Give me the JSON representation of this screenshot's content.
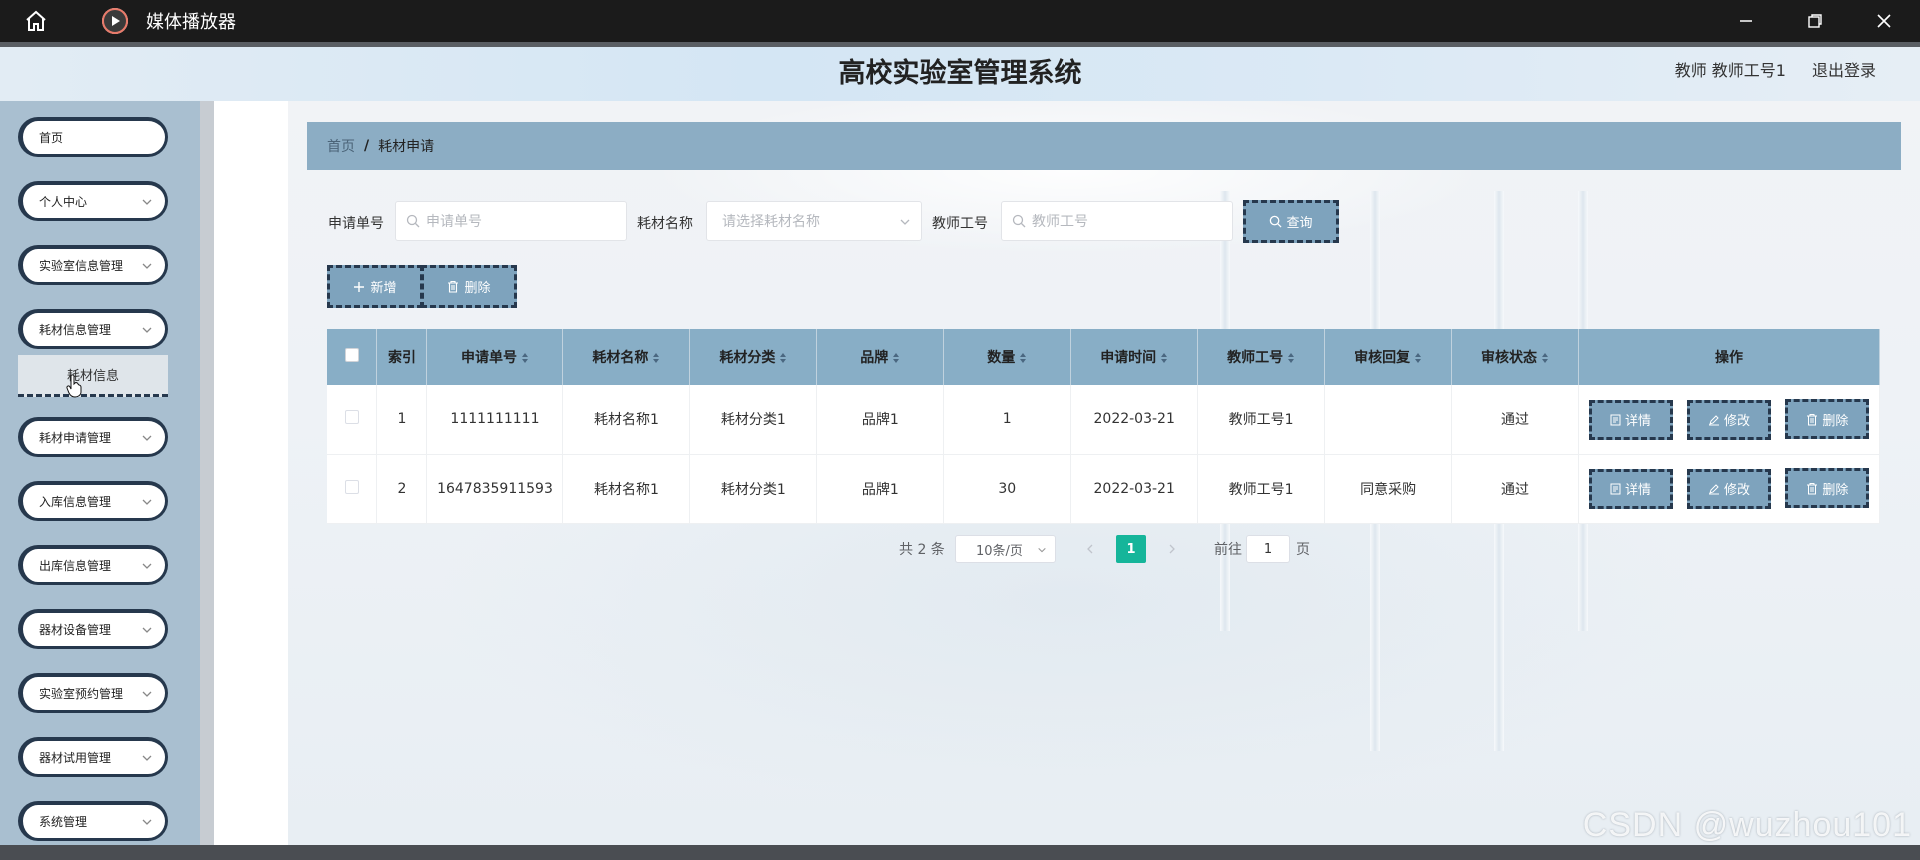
{
  "window": {
    "app_name": "媒体播放器"
  },
  "header": {
    "title": "高校实验室管理系统",
    "user": "教师 教师工号1",
    "logout": "退出登录"
  },
  "sidebar": {
    "items": [
      {
        "label": "首页",
        "has_chevron": false
      },
      {
        "label": "个人中心",
        "has_chevron": true
      },
      {
        "label": "实验室信息管理",
        "has_chevron": true
      },
      {
        "label": "耗材信息管理",
        "has_chevron": true
      },
      {
        "label": "耗材申请管理",
        "has_chevron": true
      },
      {
        "label": "入库信息管理",
        "has_chevron": true
      },
      {
        "label": "出库信息管理",
        "has_chevron": true
      },
      {
        "label": "器材设备管理",
        "has_chevron": true
      },
      {
        "label": "实验室预约管理",
        "has_chevron": true
      },
      {
        "label": "器材试用管理",
        "has_chevron": true
      },
      {
        "label": "系统管理",
        "has_chevron": true
      }
    ],
    "submenu": {
      "label": "耗材信息"
    }
  },
  "breadcrumb": {
    "home": "首页",
    "separator": "/",
    "current": "耗材申请"
  },
  "search": {
    "fields": [
      {
        "label": "申请单号",
        "placeholder": "申请单号"
      },
      {
        "label": "耗材名称",
        "placeholder": "请选择耗材名称"
      },
      {
        "label": "教师工号",
        "placeholder": "教师工号"
      }
    ],
    "query_label": "查询"
  },
  "toolbar": {
    "add_label": "新增",
    "delete_label": "删除"
  },
  "table": {
    "headers": [
      "索引",
      "申请单号",
      "耗材名称",
      "耗材分类",
      "品牌",
      "数量",
      "申请时间",
      "教师工号",
      "审核回复",
      "审核状态",
      "操作"
    ],
    "rows": [
      {
        "index": "1",
        "order_no": "1111111111",
        "name": "耗材名称1",
        "category": "耗材分类1",
        "brand": "品牌1",
        "qty": "1",
        "date": "2022-03-21",
        "teacher": "教师工号1",
        "reply": "",
        "status": "通过"
      },
      {
        "index": "2",
        "order_no": "1647835911593",
        "name": "耗材名称1",
        "category": "耗材分类1",
        "brand": "品牌1",
        "qty": "30",
        "date": "2022-03-21",
        "teacher": "教师工号1",
        "reply": "同意采购",
        "status": "通过"
      }
    ],
    "actions": {
      "detail": "详情",
      "edit": "修改",
      "delete": "删除"
    }
  },
  "pagination": {
    "total": "共 2 条",
    "page_size": "10条/页",
    "current_page": "1",
    "goto_prefix": "前往",
    "goto_value": "1",
    "goto_suffix": "页"
  },
  "watermark": "CSDN @wuzhou101",
  "colors": {
    "accent": "#7ea3bd",
    "header_row": "#88aec6",
    "dashed_border": "#26384d",
    "page_active": "#15b59a"
  }
}
